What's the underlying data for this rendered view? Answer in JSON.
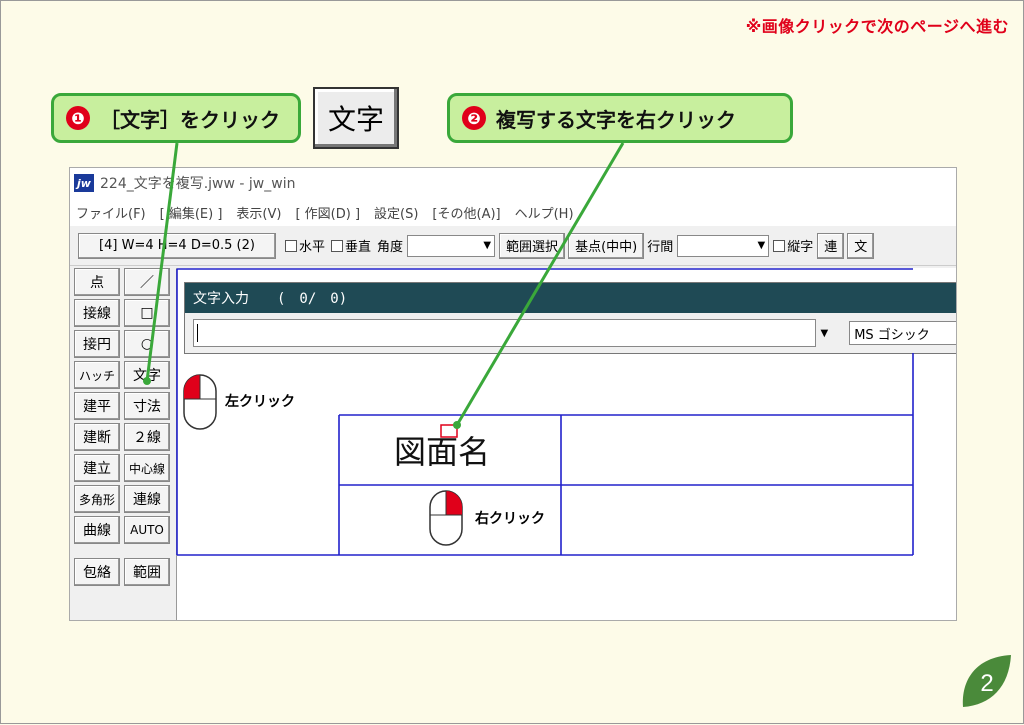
{
  "top_note": "※画像クリックで次のページへ進む",
  "callout1": {
    "num": "❶",
    "text": "［文字］をクリック"
  },
  "callout2": {
    "num": "❷",
    "text": "複写する文字を右クリック"
  },
  "big_button": "文字",
  "window": {
    "title": "224_文字を複写.jww - jw_win",
    "menu": [
      "ファイル(F)",
      "[ 編集(E) ]",
      "表示(V)",
      "[ 作図(D) ]",
      "設定(S)",
      "[その他(A)]",
      "ヘルプ(H)"
    ]
  },
  "toolbar": {
    "info": "[4] W=4 H=4 D=0.5 (2)",
    "horizontal": "水平",
    "vertical": "垂直",
    "angle": "角度",
    "range_select": "範囲選択",
    "base_point": "基点(中中)",
    "line_spacing": "行間",
    "vertical_text": "縦字",
    "ren": "連",
    "bun": "文"
  },
  "tools_left": [
    "点",
    "接線",
    "接円",
    "ハッチ",
    "建平",
    "建断",
    "建立",
    "多角形",
    "曲線",
    "包絡"
  ],
  "tools_right": [
    "／",
    "□",
    "○",
    "文字",
    "寸法",
    "２線",
    "中心線",
    "連線",
    "AUTO",
    "範囲"
  ],
  "dialog": {
    "title": "文字入力　　(　0/　0)",
    "font": "MS ゴシック"
  },
  "drawing_text": "図面名",
  "left_click": "左クリック",
  "right_click": "右クリック",
  "page_number": "2",
  "colors": {
    "callout_bg": "#c8ef9e",
    "callout_border": "#3aa83a",
    "accent_red": "#e0001a",
    "line_blue": "#2222cc"
  }
}
